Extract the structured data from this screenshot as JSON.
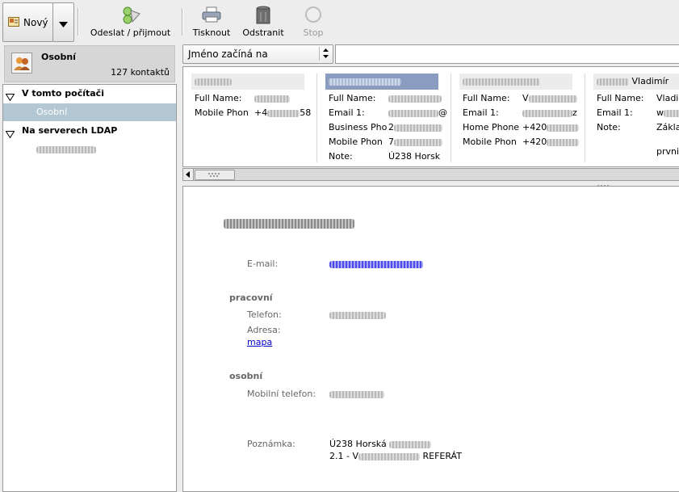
{
  "toolbar": {
    "new_label": "Nový",
    "send_receive_label": "Odeslat / přijmout",
    "print_label": "Tisknout",
    "delete_label": "Odstranit",
    "stop_label": "Stop"
  },
  "sidebar": {
    "header_title": "Osobní",
    "header_count": "127 kontaktů",
    "groups": [
      {
        "label": "V tomto počítači",
        "items": [
          "Osobní"
        ]
      },
      {
        "label": "Na serverech LDAP",
        "items": [
          ""
        ]
      }
    ]
  },
  "search": {
    "filter_value": "Jméno začíná na",
    "query": ""
  },
  "cards": [
    {
      "title": "",
      "rows": [
        {
          "k": "Full Name:",
          "v": ""
        },
        {
          "k": "Mobile Phon",
          "v": "+4"
        },
        {
          "k": "",
          "v": "58"
        }
      ]
    },
    {
      "title": "",
      "selected": true,
      "rows": [
        {
          "k": "Full Name:",
          "v": ""
        },
        {
          "k": "Email 1:",
          "v": "@"
        },
        {
          "k": "Business Pho",
          "v": "2"
        },
        {
          "k": "Mobile Phon",
          "v": "7"
        },
        {
          "k": "Note:",
          "v": "Ú238 Horsk"
        }
      ]
    },
    {
      "title": "",
      "rows": [
        {
          "k": "Full Name:",
          "v": "V"
        },
        {
          "k": "Email 1:",
          "v": "z"
        },
        {
          "k": "Home Phone",
          "v": "+420"
        },
        {
          "k": "Mobile Phon",
          "v": "+420"
        }
      ]
    },
    {
      "title": "Vladimír",
      "rows": [
        {
          "k": "Full Name:",
          "v": "Vladim"
        },
        {
          "k": "Email 1:",
          "v": "w"
        },
        {
          "k": "Note:",
          "v": "Zákla"
        },
        {
          "k": "",
          "v": "prvni"
        }
      ]
    }
  ],
  "detail": {
    "name": "",
    "email_label": "E-mail:",
    "email_value": "",
    "work_section": "pracovní",
    "phone_label": "Telefon:",
    "phone_value": "",
    "address_label": "Adresa:",
    "map_link": "mapa",
    "personal_section": "osobní",
    "mobile_label": "Mobilní telefon:",
    "mobile_value": "",
    "note_label": "Poznámka:",
    "note_line1": "Ú238 Horská",
    "note_line2_prefix": "2.1 - V",
    "note_line2_suffix": "REFERÁT"
  },
  "colors": {
    "selection_bg": "#b3c8d2",
    "card_selected": "#8b9cc1",
    "link": "#0000c8"
  }
}
